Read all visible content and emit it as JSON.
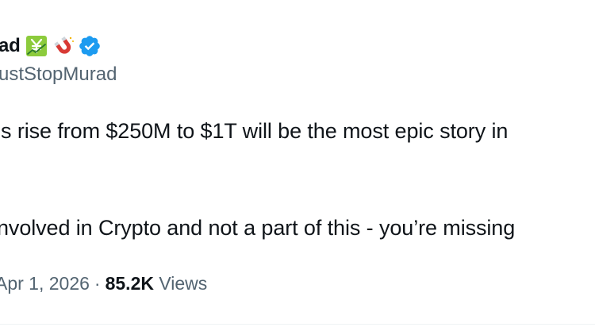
{
  "author": {
    "display_name": "ad",
    "handle": "ustStopMurad",
    "name_emojis": [
      "chart-with-upwards-trend-yen-icon",
      "magnet-icon"
    ],
    "verified": true
  },
  "tweet": {
    "line1": "'s rise from $250M to $1T will be the most epic story in",
    "line2": "nvolved in Crypto and not a part of this - you’re missing"
  },
  "meta": {
    "date": "Apr 1, 2026",
    "separator": "·",
    "views_count": "85.2K",
    "views_label": "Views"
  },
  "colors": {
    "text": "#0f1419",
    "secondary": "#536471",
    "verified_blue": "#1d9bf0",
    "emoji_green": "#8ccb3c",
    "magnet_red": "#d83a35"
  }
}
